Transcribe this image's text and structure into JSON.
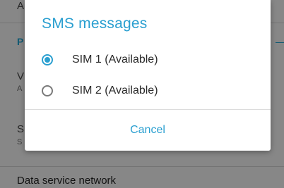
{
  "background": {
    "row_top_partial": "A",
    "section_letter": "P",
    "row_v_partial": "V",
    "row_v_sub": "A",
    "row_s_partial": "S",
    "row_s_sub": "S",
    "bottom_row_label": "Data service network"
  },
  "dialog": {
    "title": "SMS messages",
    "options": [
      {
        "label": "SIM 1 (Available)",
        "selected": true
      },
      {
        "label": "SIM 2 (Available)",
        "selected": false
      }
    ],
    "cancel_label": "Cancel"
  },
  "colors": {
    "accent": "#2a9fd0"
  }
}
